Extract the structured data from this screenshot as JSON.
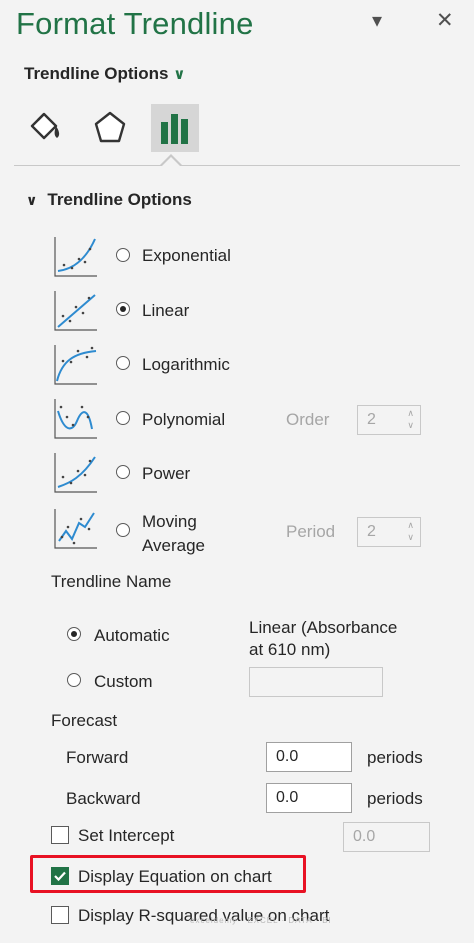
{
  "panel": {
    "title": "Format Trendline",
    "options_menu_label": "Trendline Options",
    "tabs": [
      {
        "name": "fill-line",
        "icon": "paint-bucket-icon",
        "selected": false
      },
      {
        "name": "effects",
        "icon": "pentagon-icon",
        "selected": false
      },
      {
        "name": "trendline-options",
        "icon": "bar-chart-icon",
        "selected": true
      }
    ]
  },
  "section": {
    "title": "Trendline Options",
    "types": [
      {
        "label": "Exponential",
        "selected": false
      },
      {
        "label": "Linear",
        "selected": true
      },
      {
        "label": "Logarithmic",
        "selected": false
      },
      {
        "label": "Polynomial",
        "selected": false,
        "param_label": "Order",
        "param_value": "2"
      },
      {
        "label": "Power",
        "selected": false
      },
      {
        "label": "Moving Average",
        "label_line1": "Moving",
        "label_line2": "Average",
        "selected": false,
        "param_label": "Period",
        "param_value": "2"
      }
    ]
  },
  "name": {
    "heading": "Trendline Name",
    "automatic_label": "Automatic",
    "automatic_value_line1": "Linear (Absorbance",
    "automatic_value_line2": "at 610 nm)",
    "custom_label": "Custom",
    "automatic_selected": true,
    "custom_value": ""
  },
  "forecast": {
    "heading": "Forecast",
    "forward_label": "Forward",
    "forward_value": "0.0",
    "backward_label": "Backward",
    "backward_value": "0.0",
    "unit": "periods"
  },
  "intercept": {
    "label": "Set Intercept",
    "checked": false,
    "value": "0.0"
  },
  "display_equation": {
    "label": "Display Equation on chart",
    "checked": true
  },
  "display_rsquared": {
    "label": "Display R-squared value on chart",
    "checked": false
  },
  "colors": {
    "accent": "#217346",
    "highlight": "#e81123",
    "icon_curve": "#2e8bd0"
  },
  "watermark": "exceldemy · EXCEL · DATA · BI"
}
